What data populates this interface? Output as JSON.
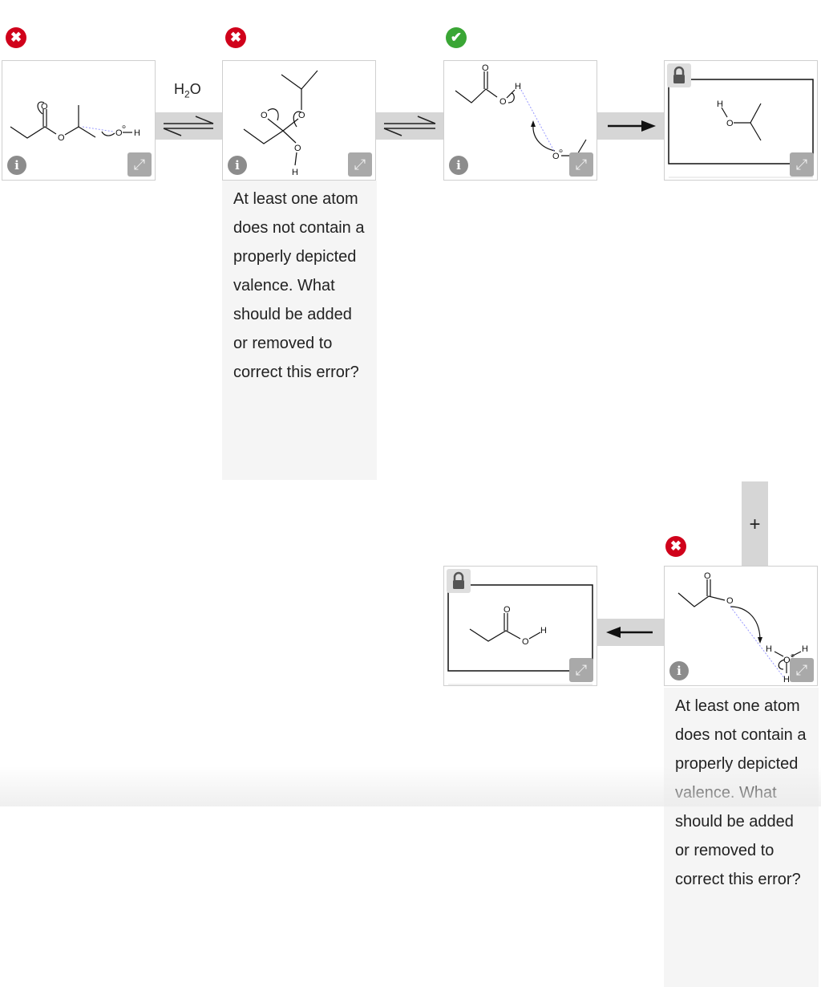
{
  "steps": [
    {
      "status": "incorrect",
      "status_icon": "x-circle-icon",
      "reagent": "H2O",
      "connector": "equilibrium"
    },
    {
      "status": "incorrect",
      "status_icon": "x-circle-icon",
      "connector": "equilibrium",
      "feedback": "At least one atom does not contain a properly depicted valence. What should be added or removed to correct this error?"
    },
    {
      "status": "correct",
      "status_icon": "check-circle-icon",
      "connector": "forward-arrow"
    },
    {
      "status": "locked",
      "connector": "plus"
    },
    {
      "status": "incorrect",
      "status_icon": "x-circle-icon",
      "connector": "reverse-arrow",
      "feedback": "At least one atom does not contain a properly depicted valence. What should be added or removed to correct this error?"
    },
    {
      "status": "locked"
    }
  ],
  "reagent": {
    "h": "H",
    "sub": "2",
    "o": "O"
  },
  "atoms": {
    "O": "O",
    "H": "H",
    "minus": "⊖",
    "plus": "⊕"
  },
  "connector_plus": "+",
  "icons": {
    "x": "✖",
    "check": "✔",
    "info": "i",
    "expand": "⤢"
  },
  "colors": {
    "error": "#d0021b",
    "success": "#3aa635",
    "band": "#d6d6d6",
    "feedback_bg": "#f5f5f5"
  }
}
